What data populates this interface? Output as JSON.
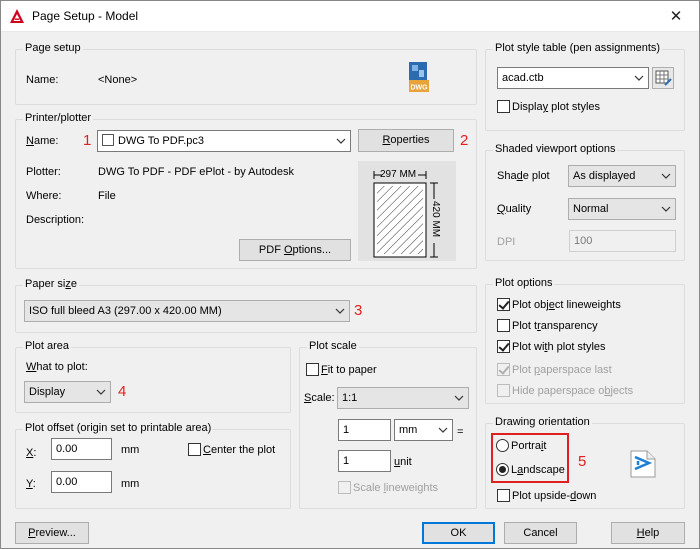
{
  "window": {
    "title": "Page Setup - Model",
    "close_glyph": "✕"
  },
  "page_setup": {
    "group_title": "Page setup",
    "name_label": "Name:",
    "name_value": "<None>",
    "file_badge": "DWG"
  },
  "printer": {
    "group_title": "Printer/plotter",
    "name_label": "Name:",
    "name_value": "DWG To PDF.pc3",
    "properties_label": "Properties",
    "plotter_label": "Plotter:",
    "plotter_value": "DWG To PDF - PDF ePlot - by Autodesk",
    "where_label": "Where:",
    "where_value": "File",
    "description_label": "Description:",
    "pdf_options_label": "PDF Options...",
    "preview_width": "297 MM",
    "preview_height": "420 MM"
  },
  "paper_size": {
    "group_title": "Paper size",
    "value": "ISO full bleed A3 (297.00 x 420.00 MM)"
  },
  "plot_area": {
    "group_title": "Plot area",
    "what_label": "What to plot:",
    "value": "Display"
  },
  "plot_offset": {
    "group_title": "Plot offset (origin set to printable area)",
    "x_label": "X:",
    "x_value": "0.00",
    "x_unit": "mm",
    "y_label": "Y:",
    "y_value": "0.00",
    "y_unit": "mm",
    "center_label": "Center the plot"
  },
  "plot_scale": {
    "group_title": "Plot scale",
    "fit_label": "Fit to paper",
    "scale_label": "Scale:",
    "scale_value": "1:1",
    "value1": "1",
    "unit1": "mm",
    "equals": "=",
    "value2": "1",
    "unit2": "unit",
    "lineweights_label": "Scale lineweights"
  },
  "plot_style": {
    "group_title": "Plot style table (pen assignments)",
    "value": "acad.ctb",
    "display_label": "Display plot styles"
  },
  "shaded": {
    "group_title": "Shaded viewport options",
    "shade_label": "Shade plot",
    "shade_value": "As displayed",
    "quality_label": "Quality",
    "quality_value": "Normal",
    "dpi_label": "DPI",
    "dpi_value": "100"
  },
  "plot_options": {
    "group_title": "Plot options",
    "items": [
      {
        "label": "Plot object lineweights"
      },
      {
        "label": "Plot transparency"
      },
      {
        "label": "Plot with plot styles"
      },
      {
        "label": "Plot paperspace last"
      },
      {
        "label": "Hide paperspace objects"
      }
    ]
  },
  "orientation": {
    "group_title": "Drawing orientation",
    "portrait_label": "Portrait",
    "landscape_label": "Landscape",
    "upside_down_label": "Plot upside-down"
  },
  "buttons": {
    "preview": "Preview...",
    "ok": "OK",
    "cancel": "Cancel",
    "help": "Help"
  },
  "annotations": {
    "n1": "1",
    "n2": "2",
    "n3": "3",
    "n4": "4",
    "n5": "5"
  },
  "colors": {
    "annotation_red": "#e02020",
    "accent_blue": "#0078d7"
  }
}
